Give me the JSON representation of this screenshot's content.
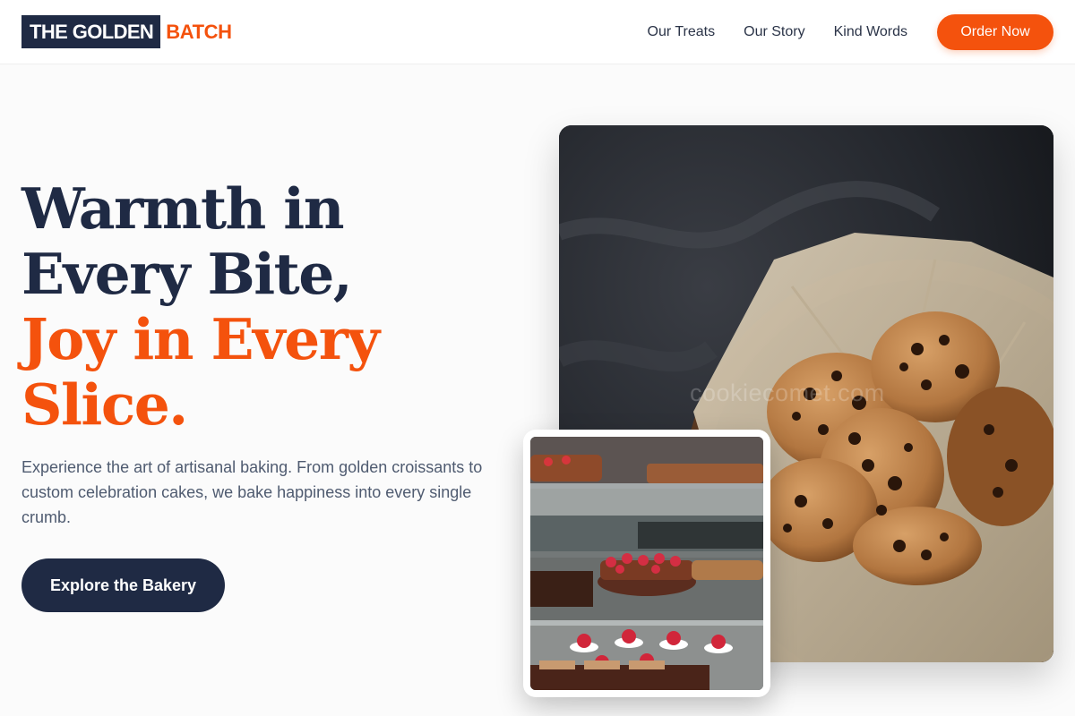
{
  "brand": {
    "logo_primary": "THE GOLDEN",
    "logo_accent": "BATCH",
    "colors": {
      "navy": "#1f2a44",
      "accent": "#f4520d"
    }
  },
  "nav": {
    "links": [
      "Our Treats",
      "Our Story",
      "Kind Words"
    ],
    "cta_label": "Order Now"
  },
  "hero": {
    "headline_lines": [
      "Warmth in",
      "Every Bite,",
      "Joy in Every",
      "Slice."
    ],
    "description": "Experience the art of artisanal baking. From golden croissants to custom celebration cakes, we bake happiness into every single crumb.",
    "cta_label": "Explore the Bakery"
  },
  "images": {
    "main_watermark": "cookiecomet.com",
    "main_icon": "cookie-basket-photo",
    "secondary_icon": "pastry-display-case-photo"
  }
}
